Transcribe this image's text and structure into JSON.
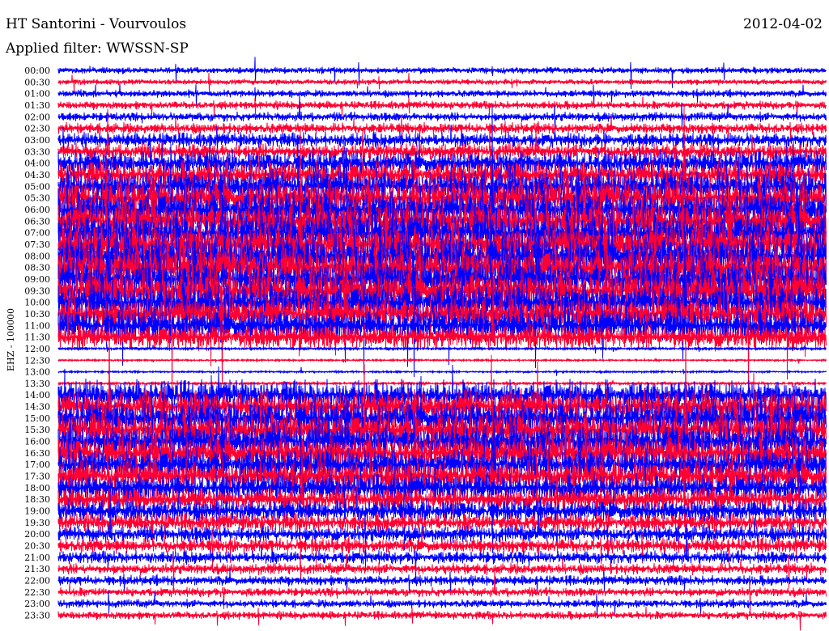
{
  "chart_data": {
    "type": "line",
    "title": "HT Santorini - Vourvoulos",
    "date": "2012-04-02",
    "subtitle": "Applied filter: WWSSN-SP",
    "ylabel": "EHZ - 100000",
    "row_labels": [
      "00:00",
      "00:30",
      "01:00",
      "01:30",
      "02:00",
      "02:30",
      "03:00",
      "03:30",
      "04:00",
      "04:30",
      "05:00",
      "05:30",
      "06:00",
      "06:30",
      "07:00",
      "07:30",
      "08:00",
      "08:30",
      "09:00",
      "09:30",
      "10:00",
      "10:30",
      "11:00",
      "11:30",
      "12:00",
      "12:30",
      "13:00",
      "13:30",
      "14:00",
      "14:30",
      "15:00",
      "15:30",
      "16:00",
      "16:30",
      "17:00",
      "17:30",
      "18:00",
      "18:30",
      "19:00",
      "19:30",
      "20:00",
      "20:30",
      "21:00",
      "21:30",
      "22:00",
      "22:30",
      "23:00",
      "23:30"
    ],
    "series_colors": [
      "#0000ff",
      "#ff0033"
    ],
    "relative_amplitude": [
      0.35,
      0.3,
      0.4,
      0.45,
      0.5,
      0.6,
      0.8,
      0.9,
      1.3,
      1.5,
      1.8,
      2.0,
      2.2,
      2.2,
      2.3,
      2.4,
      2.4,
      2.4,
      2.3,
      2.3,
      2.2,
      2.0,
      1.8,
      1.4,
      0.15,
      0.1,
      0.1,
      0.15,
      1.6,
      1.8,
      1.9,
      2.0,
      2.0,
      1.9,
      1.8,
      1.7,
      1.5,
      1.3,
      1.2,
      1.0,
      0.9,
      0.8,
      0.7,
      0.6,
      0.55,
      0.5,
      0.45,
      0.45
    ]
  }
}
